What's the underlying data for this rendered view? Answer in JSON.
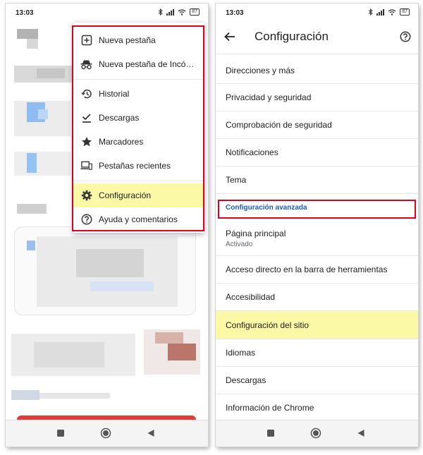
{
  "left_screen": {
    "status_time": "13:03",
    "battery": "87",
    "menu": {
      "items": [
        {
          "label": "Nueva pestaña",
          "icon": "new-tab-icon"
        },
        {
          "label": "Nueva pestaña de Incó…",
          "icon": "incognito-icon"
        },
        {
          "label": "Historial",
          "icon": "history-icon"
        },
        {
          "label": "Descargas",
          "icon": "download-check-icon"
        },
        {
          "label": "Marcadores",
          "icon": "star-icon"
        },
        {
          "label": "Pestañas recientes",
          "icon": "devices-icon"
        },
        {
          "label": "Configuración",
          "icon": "gear-icon",
          "highlighted": true
        },
        {
          "label": "Ayuda y comentarios",
          "icon": "help-icon"
        }
      ]
    }
  },
  "right_screen": {
    "status_time": "13:03",
    "battery": "87",
    "title": "Configuración",
    "items_top": [
      {
        "label": "Direcciones y más"
      },
      {
        "label": "Privacidad y seguridad"
      },
      {
        "label": "Comprobación de seguridad"
      },
      {
        "label": "Notificaciones"
      },
      {
        "label": "Tema"
      }
    ],
    "section_advanced": "Configuración avanzada",
    "items_bottom": [
      {
        "label": "Página principal",
        "sublabel": "Activado"
      },
      {
        "label": "Acceso directo en la barra de herramientas"
      },
      {
        "label": "Accesibilidad"
      },
      {
        "label": "Configuración del sitio",
        "highlighted": true
      },
      {
        "label": "Idiomas"
      },
      {
        "label": "Descargas"
      },
      {
        "label": "Información de Chrome"
      }
    ]
  },
  "colors": {
    "highlight": "#fbf8a6",
    "annotation_red": "#e0001b",
    "section_blue": "#1a5bc6"
  }
}
